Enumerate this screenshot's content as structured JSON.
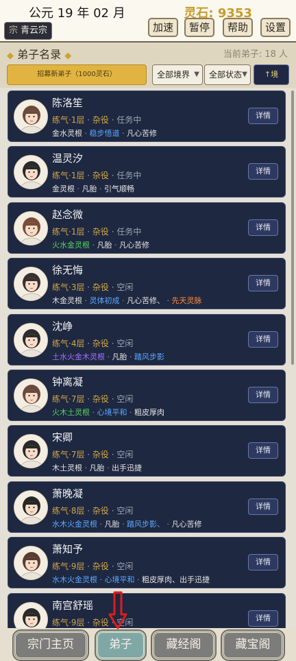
{
  "header": {
    "date": "公元 19 年 02 月",
    "spirit_stone": "灵石: 9353",
    "sect_mark": "宗",
    "sect_name": "青云宗",
    "buttons": [
      "加速",
      "暂停",
      "帮助",
      "设置"
    ]
  },
  "section": {
    "title": "弟子名录",
    "count": "当前弟子: 18 人",
    "recruit_label": "招募新弟子（1000灵石）",
    "filter_realm": "全部境界",
    "filter_status": "全部状态",
    "sort_label": "↑境"
  },
  "disciples": [
    {
      "name": "陈洛笙",
      "realm": "练气·1层",
      "role": "杂役",
      "status": "任务中",
      "root": "金水灵根",
      "root_color": "white",
      "traits": [
        {
          "text": "稳步悟道",
          "color": "blue"
        },
        {
          "text": "凡心苦修",
          "color": "white"
        }
      ]
    },
    {
      "name": "温灵汐",
      "realm": "练气·1层",
      "role": "杂役",
      "status": "任务中",
      "root": "金灵根",
      "root_color": "white",
      "traits": [
        {
          "text": "凡胎",
          "color": "white"
        },
        {
          "text": "引气顺畅",
          "color": "white"
        }
      ]
    },
    {
      "name": "赵念微",
      "realm": "练气·1层",
      "role": "杂役",
      "status": "任务中",
      "root": "火水金灵根",
      "root_color": "green",
      "traits": [
        {
          "text": "凡胎",
          "color": "white"
        },
        {
          "text": "凡心苦修",
          "color": "white"
        }
      ]
    },
    {
      "name": "徐无悔",
      "realm": "练气·3层",
      "role": "杂役",
      "status": "空闲",
      "root": "木金灵根",
      "root_color": "white",
      "traits": [
        {
          "text": "灵体初成",
          "color": "blue"
        },
        {
          "text": "凡心苦修、",
          "color": "white"
        },
        {
          "text": "先天灵脉",
          "color": "orange"
        }
      ]
    },
    {
      "name": "沈峥",
      "realm": "练气·4层",
      "role": "杂役",
      "status": "空闲",
      "root": "土水火金木灵根",
      "root_color": "purple",
      "traits": [
        {
          "text": "凡胎",
          "color": "white"
        },
        {
          "text": "踏风步影",
          "color": "blue"
        }
      ]
    },
    {
      "name": "钟离凝",
      "realm": "练气·7层",
      "role": "杂役",
      "status": "空闲",
      "root": "火木土灵根",
      "root_color": "green",
      "traits": [
        {
          "text": "心境平和",
          "color": "blue"
        },
        {
          "text": "粗皮厚肉",
          "color": "white"
        }
      ]
    },
    {
      "name": "宋卿",
      "realm": "练气·7层",
      "role": "杂役",
      "status": "空闲",
      "root": "木土灵根",
      "root_color": "white",
      "traits": [
        {
          "text": "凡胎",
          "color": "white"
        },
        {
          "text": "出手迅捷",
          "color": "white"
        }
      ]
    },
    {
      "name": "萧晚凝",
      "realm": "练气·8层",
      "role": "杂役",
      "status": "空闲",
      "root": "水木火金灵根",
      "root_color": "blue",
      "traits": [
        {
          "text": "凡胎",
          "color": "white"
        },
        {
          "text": "踏风步影、",
          "color": "blue"
        },
        {
          "text": "凡心苦修",
          "color": "white"
        }
      ]
    },
    {
      "name": "萧知予",
      "realm": "练气·9层",
      "role": "杂役",
      "status": "空闲",
      "root": "水木火金灵根",
      "root_color": "blue",
      "traits": [
        {
          "text": "心境平和",
          "color": "blue"
        },
        {
          "text": "粗皮厚肉、出手迅捷",
          "color": "white"
        }
      ]
    },
    {
      "name": "南宫舒瑶",
      "realm": "练气·9层",
      "role": "杂役",
      "status": "空闲",
      "root": "",
      "root_color": "white",
      "traits": []
    }
  ],
  "detail_label": "详情",
  "nav": [
    "宗门主页",
    "弟子",
    "藏经阁",
    "藏宝阁"
  ],
  "colors": {
    "card_bg": "#1e2841",
    "gold": "#d2a647",
    "blue": "#5aa8ff",
    "green": "#54d25f",
    "orange": "#ff8a3d",
    "purple": "#a070ff",
    "arrow_red": "#e11b1b"
  }
}
